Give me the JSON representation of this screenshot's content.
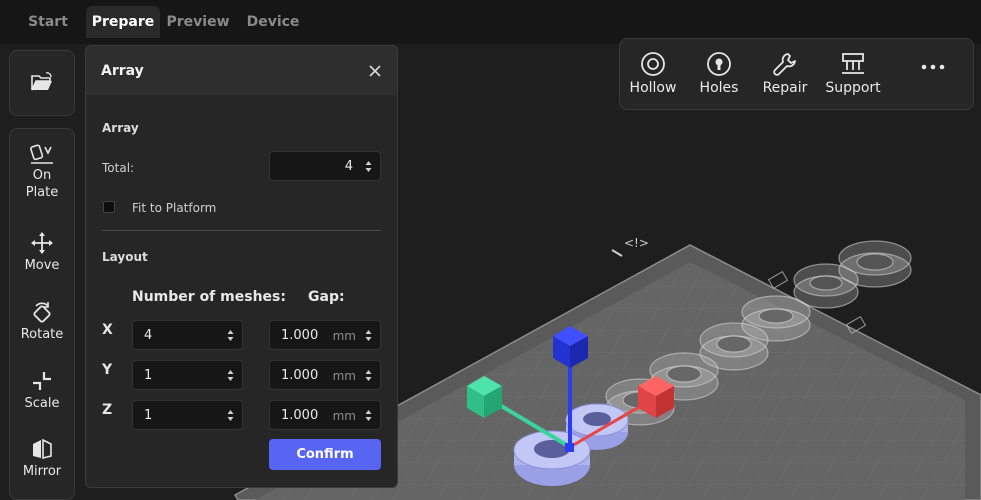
{
  "tabs": [
    {
      "label": "Start"
    },
    {
      "label": "Prepare"
    },
    {
      "label": "Preview"
    },
    {
      "label": "Device"
    }
  ],
  "active_tab": "Prepare",
  "left_toolbar": {
    "open_file_icon": "folder-open-icon",
    "tools": [
      {
        "label_line1": "On",
        "label_line2": "Plate",
        "icon": "on-plate-icon"
      },
      {
        "label_line1": "Move",
        "icon": "move-icon"
      },
      {
        "label_line1": "Rotate",
        "icon": "rotate-icon"
      },
      {
        "label_line1": "Scale",
        "icon": "scale-icon"
      },
      {
        "label_line1": "Mirror",
        "icon": "mirror-icon"
      }
    ]
  },
  "top_toolbar": {
    "tools": [
      {
        "label": "Hollow",
        "icon": "hollow-icon"
      },
      {
        "label": "Holes",
        "icon": "holes-icon"
      },
      {
        "label": "Repair",
        "icon": "wrench-icon"
      },
      {
        "label": "Support",
        "icon": "support-icon"
      }
    ],
    "more_icon": "more-horizontal-icon"
  },
  "array_panel": {
    "title": "Array",
    "section_array": "Array",
    "total_label": "Total:",
    "total_value": "4",
    "fit_label": "Fit to Platform",
    "fit_checked": false,
    "section_layout": "Layout",
    "col_meshes": "Number of meshes:",
    "col_gap": "Gap:",
    "rows": [
      {
        "axis": "X",
        "meshes": "4",
        "gap": "1.000",
        "unit": "mm"
      },
      {
        "axis": "Y",
        "meshes": "1",
        "gap": "1.000",
        "unit": "mm"
      },
      {
        "axis": "Z",
        "meshes": "1",
        "gap": "1.000",
        "unit": "mm"
      }
    ],
    "confirm_label": "Confirm"
  },
  "colors": {
    "accent": "#5865f2",
    "axis_x": "#e84545",
    "axis_y": "#3ad49a",
    "axis_z": "#2b3df0",
    "model": "#b8bdf4"
  }
}
